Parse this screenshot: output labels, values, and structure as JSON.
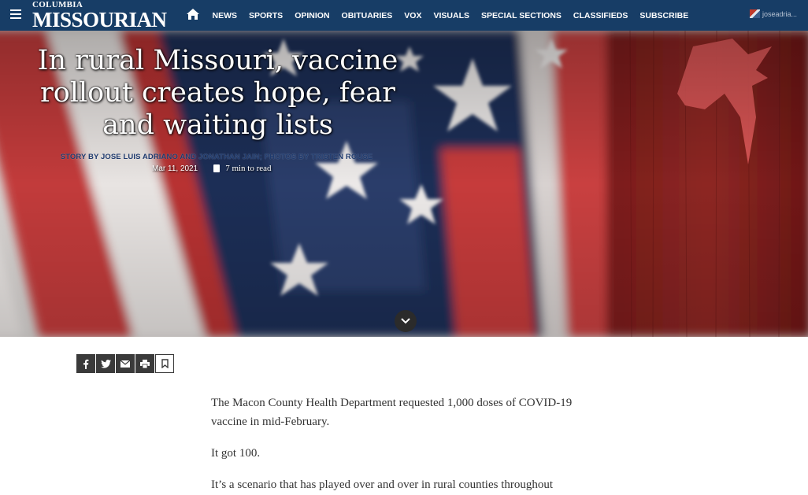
{
  "logo": {
    "top": "COLUMBIA",
    "main": "MISSOURIAN"
  },
  "nav": {
    "items": [
      "NEWS",
      "SPORTS",
      "OPINION",
      "OBITUARIES",
      "VOX",
      "VISUALS",
      "SPECIAL SECTIONS",
      "CLASSIFIEDS",
      "SUBSCRIBE"
    ]
  },
  "user": {
    "name": "joseadria..."
  },
  "hero": {
    "headline": "In rural Missouri, vaccine rollout creates hope, fear and waiting lists",
    "byline": "STORY BY JOSE LUIS ADRIANO AND JONATHAN JAIN; PHOTOS BY TRISTEN ROUSE",
    "date": "Mar 11, 2021",
    "read_time": "7 min to read"
  },
  "share": {
    "icons": [
      "facebook-icon",
      "twitter-icon",
      "email-icon",
      "print-icon",
      "bookmark-icon"
    ]
  },
  "article": {
    "paragraphs": [
      "The Macon County Health Department requested 1,000 doses of COVID-19 vaccine in mid-February.",
      "It got 100.",
      "It’s a scenario that has played over and over in rural counties throughout"
    ]
  },
  "colors": {
    "nav_bg": "#173d66",
    "byline": "#1e3a6e",
    "share_bg": "#3a3a3a"
  }
}
